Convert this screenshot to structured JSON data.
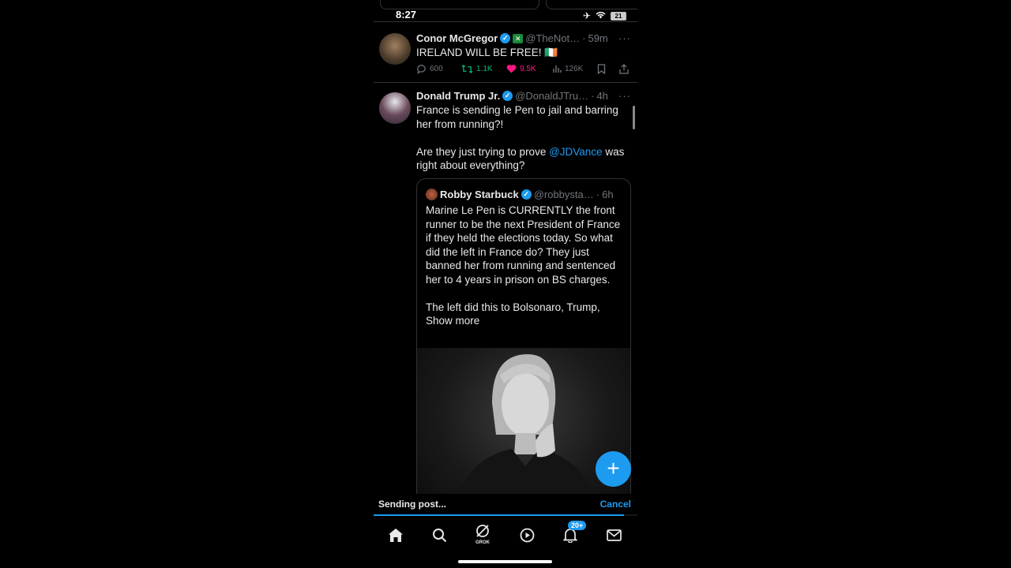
{
  "status_bar": {
    "time": "8:27",
    "battery": "21"
  },
  "tweets": [
    {
      "author": "Conor McGregor",
      "handle": "@TheNot…",
      "time": "59m",
      "text": "IRELAND WILL BE FREE! 🇮🇪",
      "replies": "600",
      "reposts": "1.1K",
      "likes": "9.5K",
      "views": "126K"
    },
    {
      "author": "Donald Trump Jr.",
      "handle": "@DonaldJTru…",
      "time": "4h",
      "text_1": "France is sending le Pen to jail and barring her from running?!",
      "text_2_before": "Are they just trying to prove ",
      "mention": "@JDVance",
      "text_2_after": " was right about everything?"
    }
  ],
  "quote": {
    "author": "Robby Starbuck",
    "handle": "@robbysta…",
    "time": "6h",
    "text": "Marine Le Pen is CURRENTLY the front runner to be the next President of France if they held the elections today. So what did the left in France do? They just banned her from running and sentenced her to 4 years in prison on BS charges.",
    "text_2": "The left did this to Bolsonaro, Trump,",
    "show_more": "Show more"
  },
  "sending": {
    "label": "Sending post...",
    "cancel": "Cancel",
    "progress": 0.95
  },
  "nav": {
    "grok_label": "GROK",
    "notification_count": "20+"
  },
  "colors": {
    "accent": "#1d9bf0",
    "like": "#f91880",
    "repost": "#00ba7c",
    "background": "#000000"
  }
}
